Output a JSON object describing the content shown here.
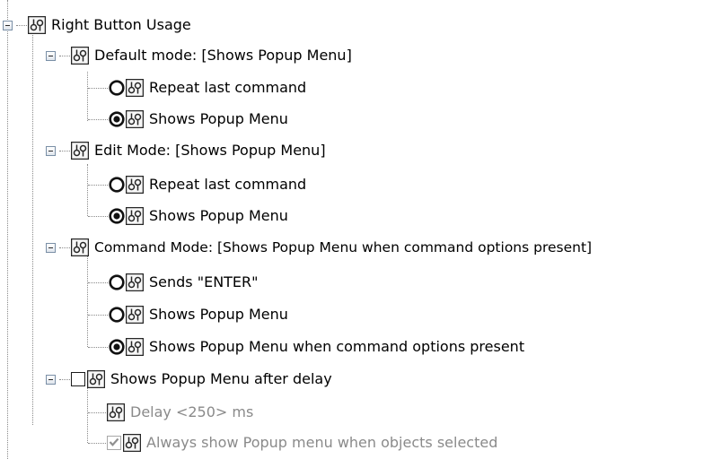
{
  "tree": {
    "root": {
      "label": "Right Button Usage",
      "icon": "options-icon"
    },
    "groups": [
      {
        "label": "Default mode: [Shows Popup Menu]",
        "options": [
          {
            "label": "Repeat last command",
            "control": "radio",
            "selected": false
          },
          {
            "label": "Shows Popup Menu",
            "control": "radio",
            "selected": true
          }
        ]
      },
      {
        "label": "Edit Mode: [Shows Popup Menu]",
        "options": [
          {
            "label": "Repeat last command",
            "control": "radio",
            "selected": false
          },
          {
            "label": "Shows Popup Menu",
            "control": "radio",
            "selected": true
          }
        ]
      },
      {
        "label": "Command Mode: [Shows Popup Menu when command options present]",
        "options": [
          {
            "label": "Sends \"ENTER\"",
            "control": "radio",
            "selected": false
          },
          {
            "label": "Shows Popup Menu",
            "control": "radio",
            "selected": false
          },
          {
            "label": "Shows Popup Menu when command options present",
            "control": "radio",
            "selected": true
          }
        ]
      },
      {
        "label": "Shows Popup Menu after delay",
        "control": "checkbox",
        "checked": false,
        "options": [
          {
            "label": "Delay <250> ms",
            "control": "none",
            "disabled": true
          },
          {
            "label": "Always show Popup menu when objects selected",
            "control": "checkbox",
            "checked": true,
            "disabled": true
          }
        ]
      }
    ]
  },
  "colors": {
    "text": "#000000",
    "disabled_text": "#8a8a8a",
    "tree_lines": "#8a8a8a"
  }
}
